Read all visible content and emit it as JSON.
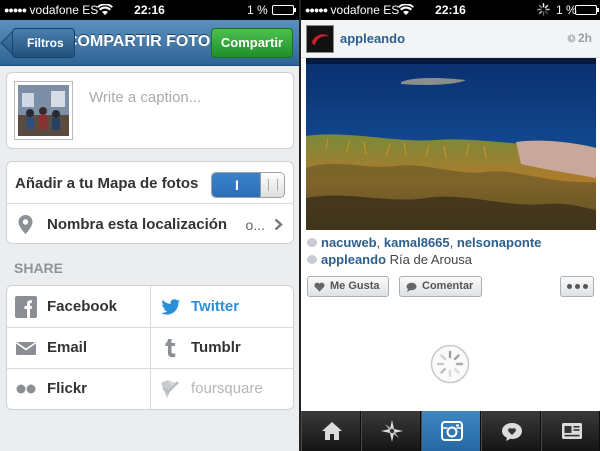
{
  "left": {
    "status": {
      "carrier": "vodafone ES",
      "time": "22:16",
      "battery": "1 %"
    },
    "nav": {
      "back_label": "Filtros",
      "title": "COMPARTIR FOTO",
      "share_label": "Compartir"
    },
    "caption": {
      "placeholder": "Write a caption..."
    },
    "photo_map": {
      "label": "Añadir a tu Mapa de fotos",
      "toggle_on": "I"
    },
    "location": {
      "label": "Nombra esta localización",
      "value": "o..."
    },
    "share": {
      "heading": "SHARE",
      "items": [
        {
          "label": "Facebook",
          "icon": "facebook-icon",
          "active": false
        },
        {
          "label": "Twitter",
          "icon": "twitter-icon",
          "active": true
        },
        {
          "label": "Email",
          "icon": "email-icon",
          "active": false
        },
        {
          "label": "Tumblr",
          "icon": "tumblr-icon",
          "active": false
        },
        {
          "label": "Flickr",
          "icon": "flickr-icon",
          "active": false
        },
        {
          "label": "foursquare",
          "icon": "foursquare-icon",
          "active": false
        }
      ]
    }
  },
  "right": {
    "status": {
      "carrier": "vodafone ES",
      "time": "22:16",
      "battery": "1 %"
    },
    "post": {
      "username": "appleando",
      "age": "2h",
      "likes": [
        "nacuweb",
        "kamal8665",
        "nelsonaponte"
      ],
      "likes_sep": ", ",
      "comment_user": "appleando",
      "comment_text": "Ría de Arousa",
      "like_button": "Me Gusta",
      "comment_button": "Comentar"
    },
    "tabs": [
      "home-icon",
      "explore-icon",
      "camera-icon",
      "news-icon",
      "profile-icon"
    ],
    "active_tab": 2
  },
  "colors": {
    "nav_blue": "#3b75a8",
    "share_green": "#2ea33a",
    "link_blue": "#2c5f8d",
    "twitter_blue": "#2b8fd6"
  }
}
